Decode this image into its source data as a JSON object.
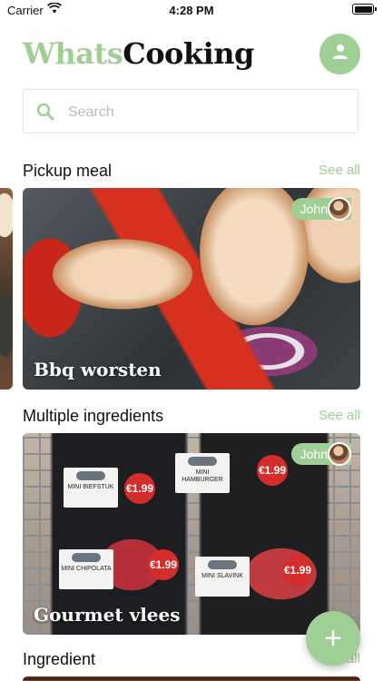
{
  "status_bar": {
    "carrier": "Carrier",
    "time": "4:28 PM"
  },
  "header": {
    "brand_part1": "Whats",
    "brand_part2": "Cooking",
    "profile_icon": "person-icon"
  },
  "search": {
    "placeholder": "Search",
    "value": ""
  },
  "sections": [
    {
      "title": "Pickup meal",
      "see_all": "See all",
      "cards": [
        {
          "title": "Bbq worsten",
          "user": "John"
        }
      ]
    },
    {
      "title": "Multiple ingredients",
      "see_all": "See all",
      "cards": [
        {
          "title": "Gourmet vlees",
          "user": "John",
          "packs": [
            {
              "name": "MINI BIEFSTUK",
              "price": "€1.99"
            },
            {
              "name": "MINI HAMBURGER",
              "price": "€1.99"
            },
            {
              "name": "MINI CHIPOLATA",
              "price": "€1.99"
            },
            {
              "name": "MINI SLAVINK",
              "price": "€1.99"
            }
          ]
        }
      ]
    },
    {
      "title": "Ingredient",
      "see_all": "See all",
      "cards": []
    }
  ],
  "fab": {
    "label": "+",
    "icon": "plus-icon"
  },
  "colors": {
    "accent": "#9fcf95",
    "text": "#111111",
    "placeholder": "#b9b9b9"
  }
}
